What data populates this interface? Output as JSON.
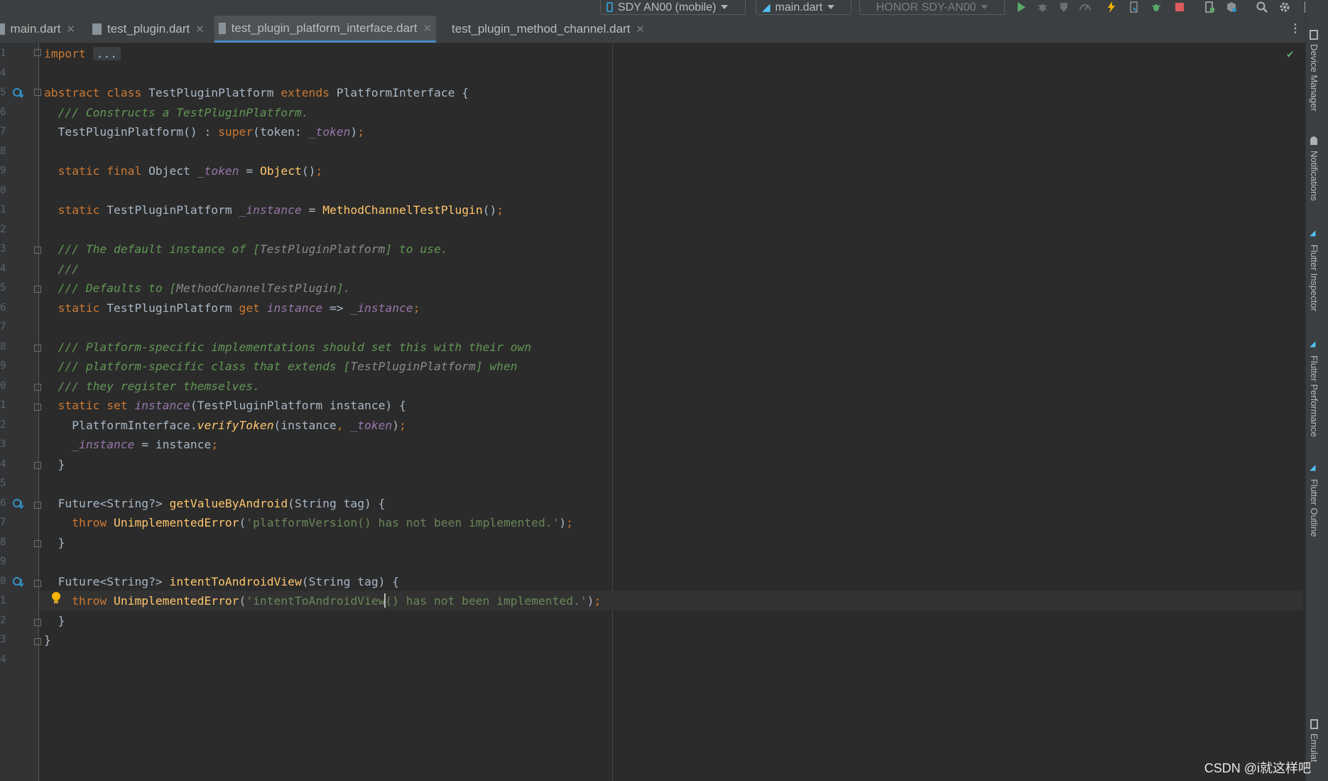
{
  "toolbar": {
    "device": "SDY AN00 (mobile)",
    "run_config": "main.dart",
    "target_device": "HONOR SDY-AN00"
  },
  "tabs": [
    {
      "label": "main.dart"
    },
    {
      "label": "test_plugin.dart"
    },
    {
      "label": "test_plugin_platform_interface.dart",
      "active": true
    },
    {
      "label": "test_plugin_method_channel.dart"
    }
  ],
  "editor": {
    "line_numbers": [
      "1",
      "4",
      "5",
      "6",
      "7",
      "8",
      "9",
      "0",
      "1",
      "2",
      "3",
      "4",
      "5",
      "6",
      "7",
      "8",
      "9",
      "0",
      "1",
      "2",
      "3",
      "4",
      "5",
      "6",
      "7",
      "8",
      "9",
      "0",
      "1",
      "2",
      "3",
      "4"
    ],
    "code_lines": [
      "import ...",
      "",
      "abstract class TestPluginPlatform extends PlatformInterface {",
      "  /// Constructs a TestPluginPlatform.",
      "  TestPluginPlatform() : super(token: _token);",
      "",
      "  static final Object _token = Object();",
      "",
      "  static TestPluginPlatform _instance = MethodChannelTestPlugin();",
      "",
      "  /// The default instance of [TestPluginPlatform] to use.",
      "  ///",
      "  /// Defaults to [MethodChannelTestPlugin].",
      "  static TestPluginPlatform get instance => _instance;",
      "",
      "  /// Platform-specific implementations should set this with their own",
      "  /// platform-specific class that extends [TestPluginPlatform] when",
      "  /// they register themselves.",
      "  static set instance(TestPluginPlatform instance) {",
      "    PlatformInterface.verifyToken(instance, _token);",
      "    _instance = instance;",
      "  }",
      "",
      "  Future<String?> getValueByAndroid(String tag) {",
      "    throw UnimplementedError('platformVersion() has not been implemented.');",
      "  }",
      "",
      "  Future<String?> intentToAndroidView(String tag) {",
      "    throw UnimplementedError('intentToAndroidView() has not been implemented.');",
      "  }",
      "}",
      ""
    ]
  },
  "side_panels": {
    "device_manager": "Device Manager",
    "notifications": "Notifications",
    "flutter_inspector": "Flutter Inspector",
    "flutter_performance": "Flutter Performance",
    "flutter_outline": "Flutter Outline",
    "emulator": "Emulat"
  },
  "watermark": "CSDN @i就这样吧",
  "colors": {
    "keyword": "#cc7832",
    "comment": "#629755",
    "field": "#9876aa",
    "function": "#ffc66d",
    "string": "#6a8759",
    "text": "#a9b7c6",
    "background": "#2b2b2b",
    "accent": "#4a88c7"
  }
}
